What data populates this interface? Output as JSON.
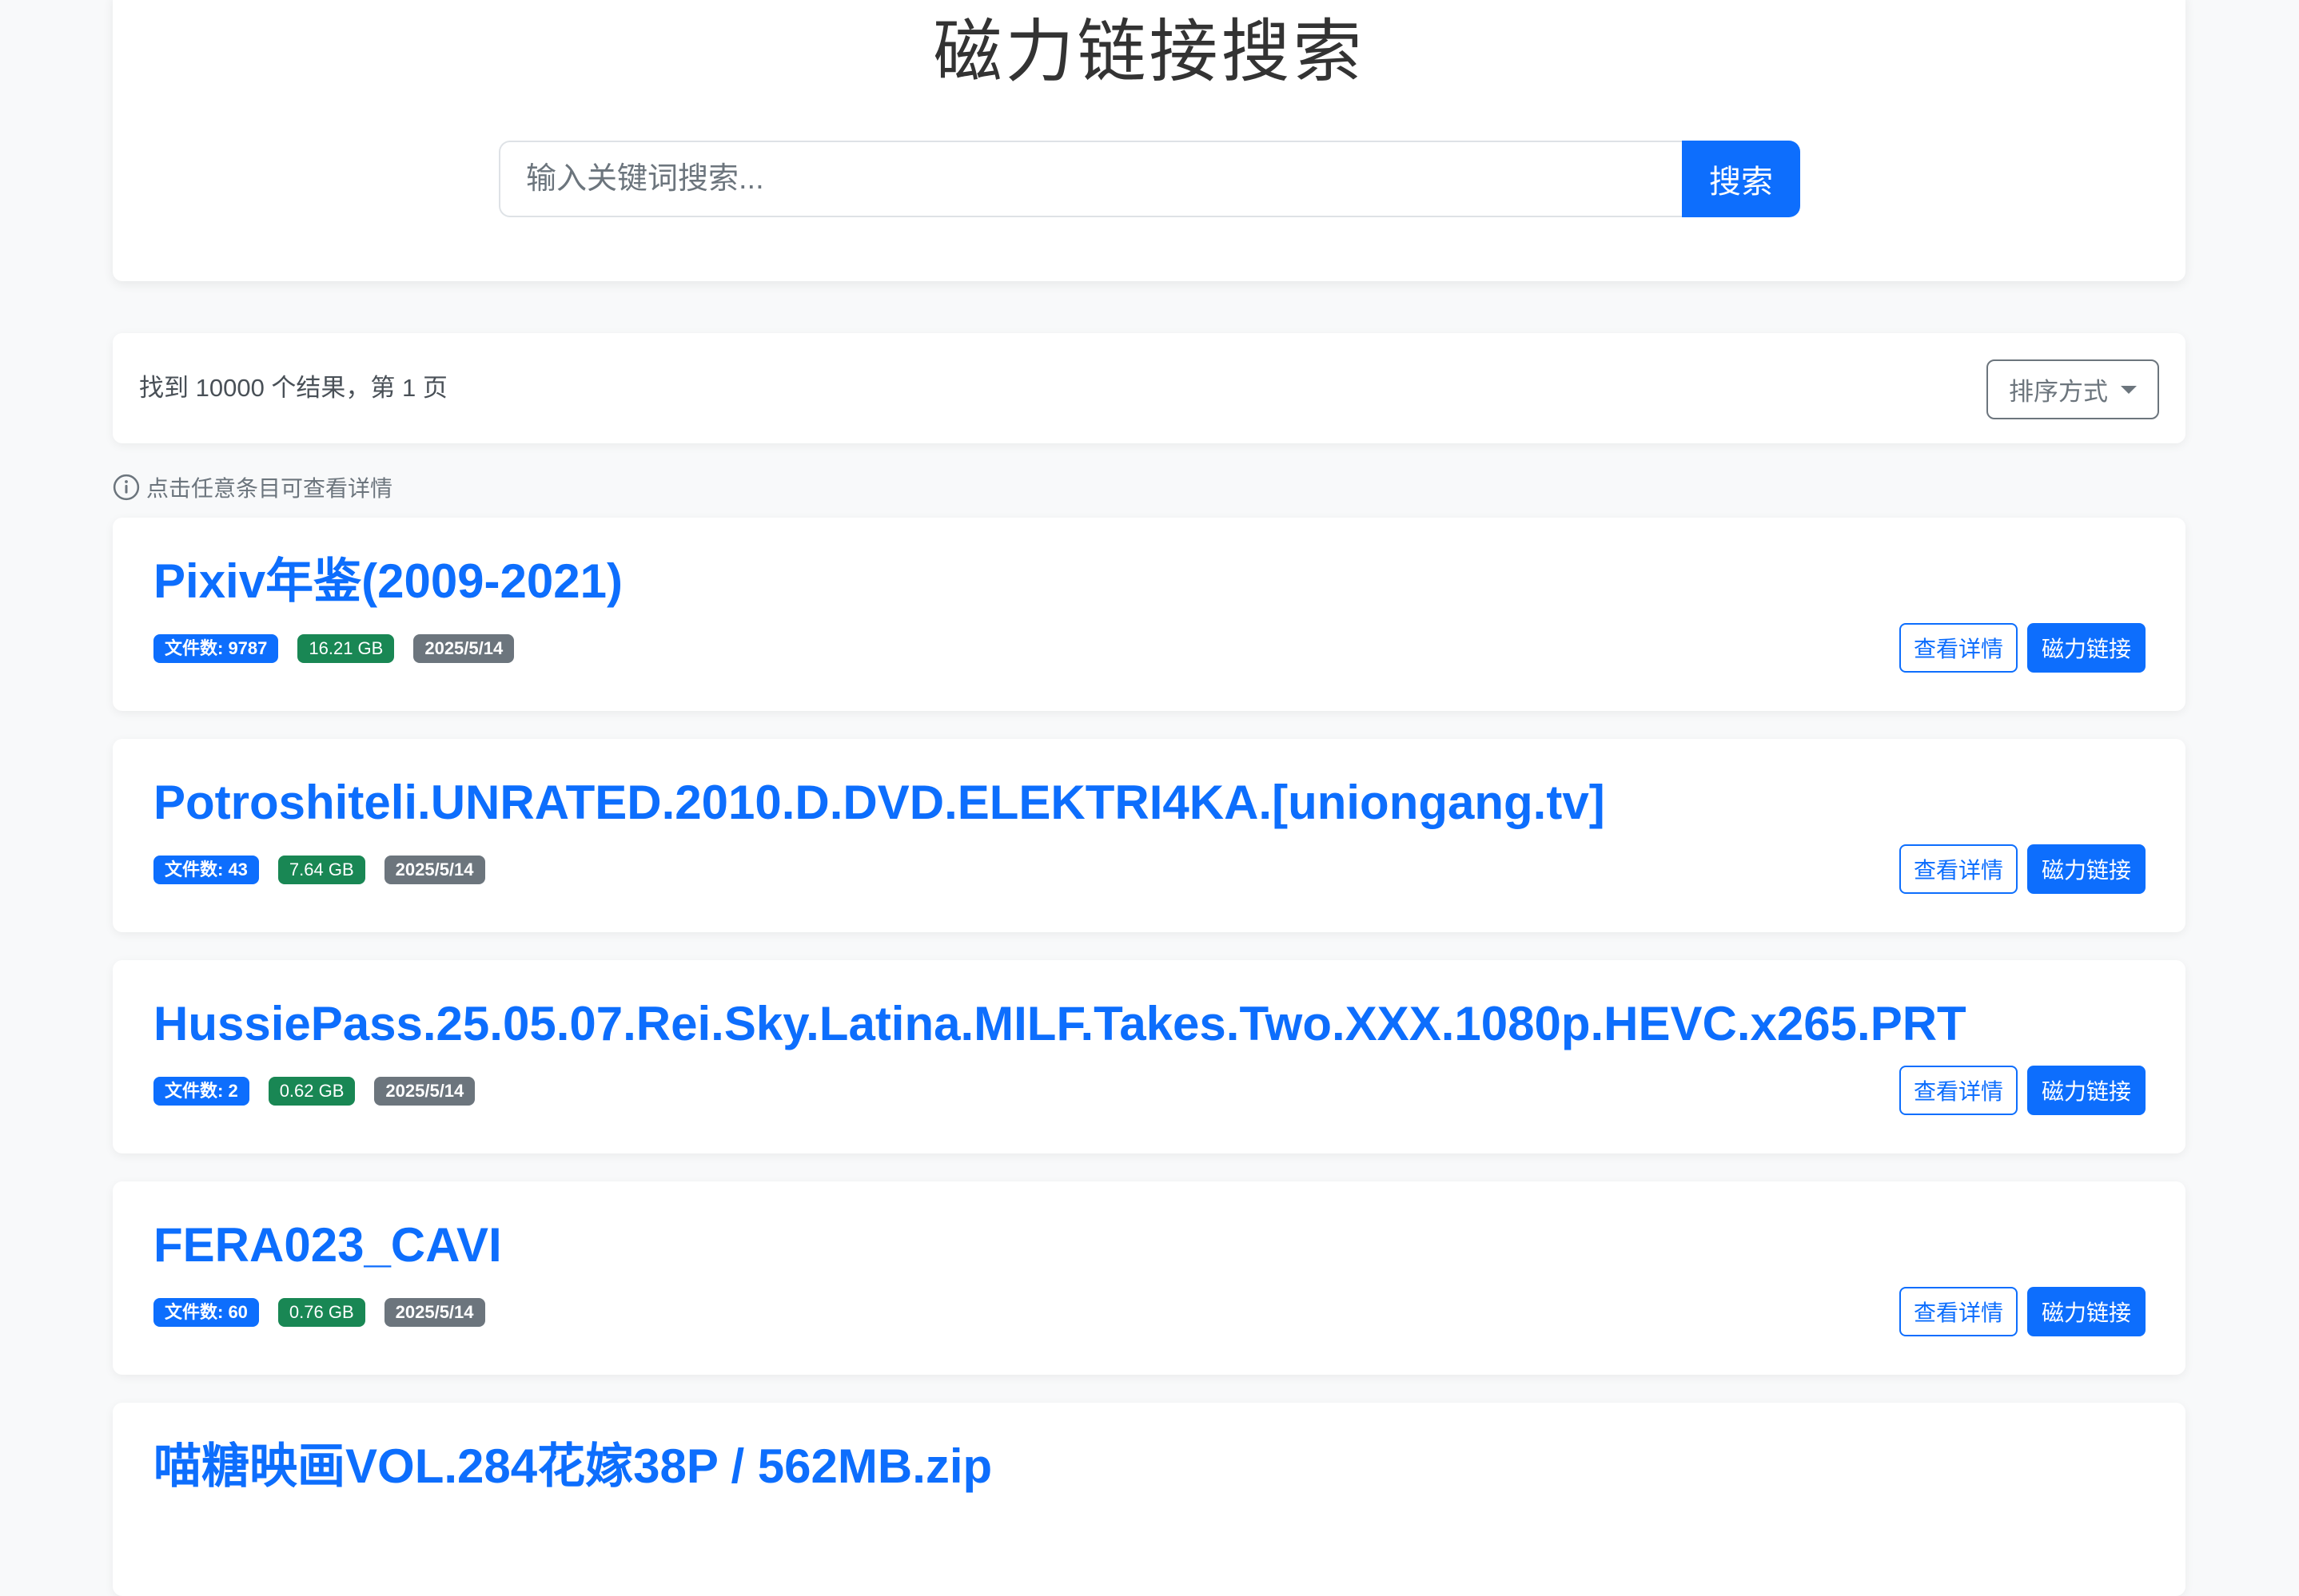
{
  "header": {
    "title": "磁力链接搜索",
    "search_placeholder": "输入关键词搜索...",
    "search_value": "",
    "search_button": "搜索"
  },
  "results_bar": {
    "count_text": "找到 10000 个结果，第 1 页",
    "sort_label": "排序方式"
  },
  "hint": {
    "text": "点击任意条目可查看详情",
    "icon": "info-circle-icon"
  },
  "actions": {
    "detail_label": "查看详情",
    "magnet_label": "磁力链接"
  },
  "results": [
    {
      "title": "Pixiv年鉴(2009-2021)",
      "files": "文件数: 9787",
      "size": "16.21 GB",
      "date": "2025/5/14"
    },
    {
      "title": "Potroshiteli.UNRATED.2010.D.DVD.ELEKTRI4KA.[uniongang.tv]",
      "files": "文件数: 43",
      "size": "7.64 GB",
      "date": "2025/5/14"
    },
    {
      "title": "HussiePass.25.05.07.Rei.Sky.Latina.MILF.Takes.Two.XXX.1080p.HEVC.x265.PRT",
      "files": "文件数: 2",
      "size": "0.62 GB",
      "date": "2025/5/14"
    },
    {
      "title": "FERA023_CAVI",
      "files": "文件数: 60",
      "size": "0.76 GB",
      "date": "2025/5/14"
    },
    {
      "title": "喵糖映画VOL.284花嫁38P / 562MB.zip"
    }
  ],
  "colors": {
    "primary": "#0d6efd",
    "success": "#198754",
    "secondary": "#6c757d",
    "background": "#f8f9fa"
  }
}
